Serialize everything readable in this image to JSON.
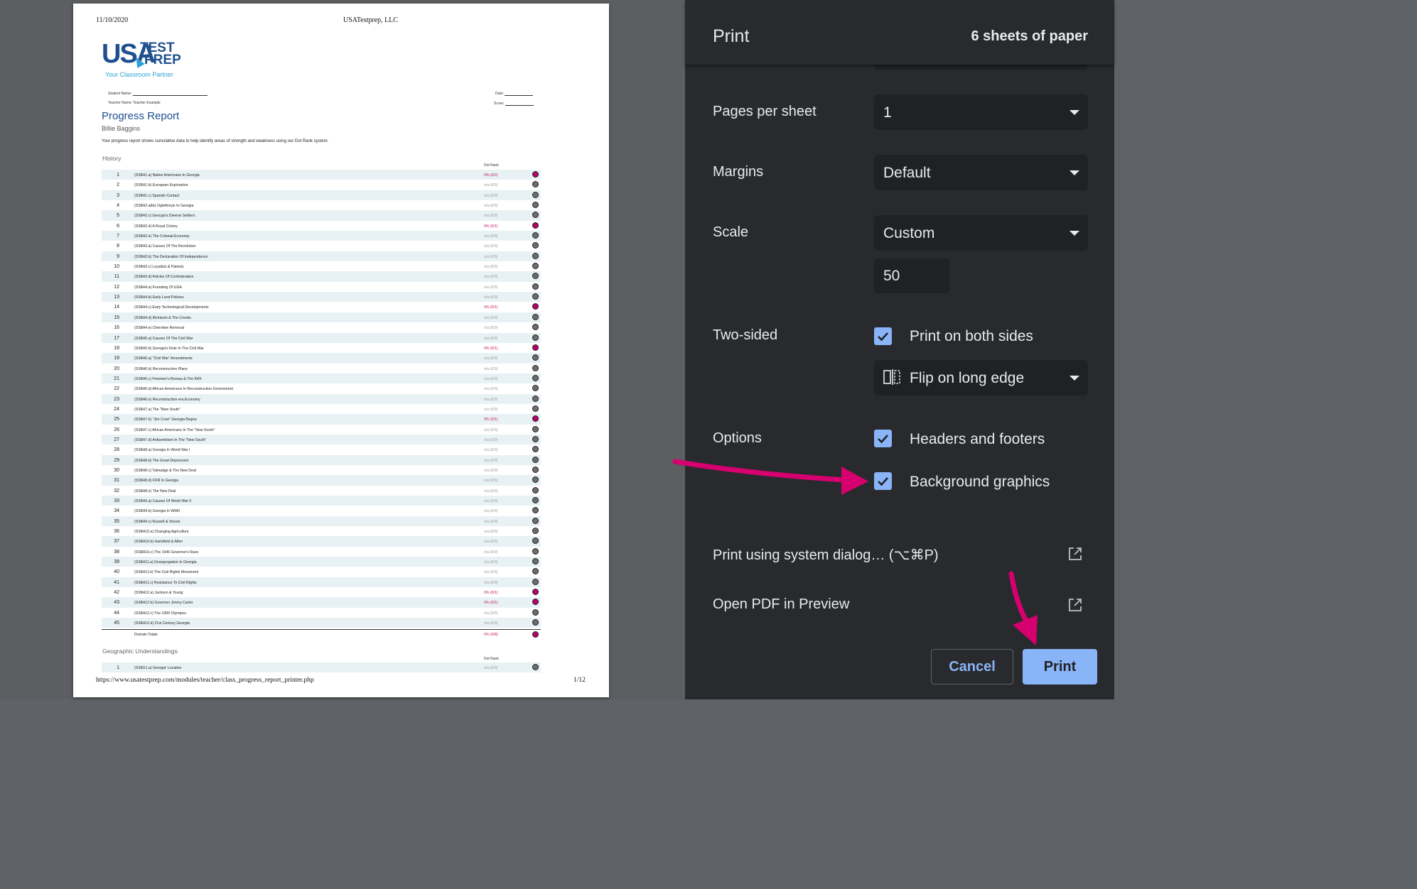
{
  "preview": {
    "header_date": "11/10/2020",
    "header_company": "USATestprep, LLC",
    "logo": {
      "usa": "USA",
      "test": "TEST",
      "prep": "PREP",
      "tagline": "Your Classroom Partner"
    },
    "student_name_label": "Student Name:",
    "teacher_name_label": "Teacher Name: Teacher Example",
    "date_label": "Date:",
    "score_label": "Score:",
    "report_title": "Progress Report",
    "student": "Billie Baggins",
    "description": "Your progress report shows cumulative data to help identify areas of strength and weakness using our Dot Rank system.",
    "section1": "History",
    "dot_rank_label": "Dot Rank",
    "rows": [
      {
        "n": "1",
        "name": "(SS8H1.a) Native Americans In Georgia",
        "pct": "0% (0/2)",
        "hit": true
      },
      {
        "n": "2",
        "name": "(SS8H1.b) European Exploration",
        "pct": "n/a (0/0)",
        "hit": false
      },
      {
        "n": "3",
        "name": "(SS8H1.c) Spanish Contact",
        "pct": "n/a (0/0)",
        "hit": false
      },
      {
        "n": "4",
        "name": "(SS8H2.a&b) Oglethorpe In Georgia",
        "pct": "n/a (0/0)",
        "hit": false
      },
      {
        "n": "5",
        "name": "(SS8H2.c) Georgia's Diverse Settlers",
        "pct": "n/a (0/0)",
        "hit": false
      },
      {
        "n": "6",
        "name": "(SS8H2.d) A Royal Colony",
        "pct": "0% (0/1)",
        "hit": true
      },
      {
        "n": "7",
        "name": "(SS8H2.e) The Colonial Economy",
        "pct": "n/a (0/0)",
        "hit": false
      },
      {
        "n": "8",
        "name": "(SS8H3.a) Causes Of The Revolution",
        "pct": "n/a (0/0)",
        "hit": false
      },
      {
        "n": "9",
        "name": "(SS8H3.b) The Declaration Of Independence",
        "pct": "n/a (0/0)",
        "hit": false
      },
      {
        "n": "10",
        "name": "(SS8H3.c) Loyalists & Patriots",
        "pct": "n/a (0/0)",
        "hit": false
      },
      {
        "n": "11",
        "name": "(SS8H3.d) Articles Of Confederation",
        "pct": "n/a (0/0)",
        "hit": false
      },
      {
        "n": "12",
        "name": "(SS8H4.a) Founding Of UGA",
        "pct": "n/a (0/0)",
        "hit": false
      },
      {
        "n": "13",
        "name": "(SS8H4.b) Early Land Policies",
        "pct": "n/a (0/0)",
        "hit": false
      },
      {
        "n": "14",
        "name": "(SS8H4.c) Early Technological Developments",
        "pct": "0% (0/1)",
        "hit": true
      },
      {
        "n": "15",
        "name": "(SS8H4.d) McIntosh & The Creeks",
        "pct": "n/a (0/0)",
        "hit": false
      },
      {
        "n": "16",
        "name": "(SS8H4.e) Cherokee Removal",
        "pct": "n/a (0/0)",
        "hit": false
      },
      {
        "n": "17",
        "name": "(SS8H5.a) Causes Of The Civil War",
        "pct": "n/a (0/0)",
        "hit": false
      },
      {
        "n": "18",
        "name": "(SS8H5.b) Georgia's Role In The Civil War",
        "pct": "0% (0/1)",
        "hit": true
      },
      {
        "n": "19",
        "name": "(SS8H6.a) \"Civil War\" Amendments",
        "pct": "n/a (0/0)",
        "hit": false
      },
      {
        "n": "20",
        "name": "(SS8H6.b) Reconstruction Plans",
        "pct": "n/a (0/0)",
        "hit": false
      },
      {
        "n": "21",
        "name": "(SS8H6.c) Freemen's Bureau & The KKK",
        "pct": "n/a (0/0)",
        "hit": false
      },
      {
        "n": "22",
        "name": "(SS8H6.d) African Americans In Reconstruction Government",
        "pct": "n/a (0/0)",
        "hit": false
      },
      {
        "n": "23",
        "name": "(SS8H6.e) Reconstruction-era Economy",
        "pct": "n/a (0/0)",
        "hit": false
      },
      {
        "n": "24",
        "name": "(SS8H7.a) The \"New South\"",
        "pct": "n/a (0/0)",
        "hit": false
      },
      {
        "n": "25",
        "name": "(SS8H7.b) \"Jim Crow\" Georgia Begins",
        "pct": "0% (0/1)",
        "hit": true
      },
      {
        "n": "26",
        "name": "(SS8H7.c) African Americans In The \"New South\"",
        "pct": "n/a (0/0)",
        "hit": false
      },
      {
        "n": "27",
        "name": "(SS8H7.d) Antisemitism In The \"New South\"",
        "pct": "n/a (0/0)",
        "hit": false
      },
      {
        "n": "28",
        "name": "(SS8H8.a) Georgia In World War I",
        "pct": "n/a (0/0)",
        "hit": false
      },
      {
        "n": "29",
        "name": "(SS8H8.b) The Great Depression",
        "pct": "n/a (0/0)",
        "hit": false
      },
      {
        "n": "30",
        "name": "(SS8H8.c) Talmadge & The New Deal",
        "pct": "n/a (0/0)",
        "hit": false
      },
      {
        "n": "31",
        "name": "(SS8H8.d) FDR In Georgia",
        "pct": "n/a (0/0)",
        "hit": false
      },
      {
        "n": "32",
        "name": "(SS8H8.e) The New Deal",
        "pct": "n/a (0/0)",
        "hit": false
      },
      {
        "n": "33",
        "name": "(SS8H9.a) Causes Of World War II",
        "pct": "n/a (0/0)",
        "hit": false
      },
      {
        "n": "34",
        "name": "(SS8H9.b) Georgia In WWII",
        "pct": "n/a (0/0)",
        "hit": false
      },
      {
        "n": "35",
        "name": "(SS8H9.c) Russell & Vinson",
        "pct": "n/a (0/0)",
        "hit": false
      },
      {
        "n": "36",
        "name": "(SS8H10.a) Changing Agriculture",
        "pct": "n/a (0/0)",
        "hit": false
      },
      {
        "n": "37",
        "name": "(SS8H10.b) Hartsfield & Allen",
        "pct": "n/a (0/0)",
        "hit": false
      },
      {
        "n": "38",
        "name": "(SS8H10.c) The 1946 Governor's Race",
        "pct": "n/a (0/0)",
        "hit": false
      },
      {
        "n": "39",
        "name": "(SS8H11.a) Desegregation In Georgia",
        "pct": "n/a (0/0)",
        "hit": false
      },
      {
        "n": "40",
        "name": "(SS8H11.b) The Civil Rights Movement",
        "pct": "n/a (0/0)",
        "hit": false
      },
      {
        "n": "41",
        "name": "(SS8H11.c) Resistance To Civil Rights",
        "pct": "n/a (0/0)",
        "hit": false
      },
      {
        "n": "42",
        "name": "(SS8H12.a) Jackson & Young",
        "pct": "0% (0/1)",
        "hit": true
      },
      {
        "n": "43",
        "name": "(SS8H12.b) Governor Jimmy Carter",
        "pct": "0% (0/1)",
        "hit": true
      },
      {
        "n": "44",
        "name": "(SS8H12.c) The 1996 Olympics",
        "pct": "n/a (0/0)",
        "hit": false
      },
      {
        "n": "45",
        "name": "(SS8H12.d) 21st Century Georgia",
        "pct": "n/a (0/0)",
        "hit": false
      }
    ],
    "totals_label": "Domain Totals",
    "totals_pct": "0% (0/8)",
    "section2": "Geographic Understandings",
    "section2_rows": [
      {
        "n": "1",
        "name": "(SS8G1.a) Georgia' Location",
        "pct": "n/a (0/0)",
        "hit": false
      }
    ],
    "footer_url": "https://www.usatestprep.com/modules/teacher/class_progress_report_printer.php",
    "footer_page": "1/12"
  },
  "panel": {
    "title": "Print",
    "sheets": "6 sheets of paper",
    "pages_per_sheet_label": "Pages per sheet",
    "pages_per_sheet_value": "1",
    "margins_label": "Margins",
    "margins_value": "Default",
    "scale_label": "Scale",
    "scale_value": "Custom",
    "scale_custom": "50",
    "two_sided_label": "Two-sided",
    "two_sided_checkbox": "Print on both sides",
    "two_sided_checked": true,
    "flip_value": "Flip on long edge",
    "options_label": "Options",
    "headers_footers": "Headers and footers",
    "headers_footers_checked": true,
    "background_graphics": "Background graphics",
    "background_graphics_checked": true,
    "system_dialog": "Print using system dialog… (⌥⌘P)",
    "open_pdf": "Open PDF in Preview",
    "cancel": "Cancel",
    "print": "Print"
  },
  "colors": {
    "accent": "#8ab4f8",
    "annotation_arrow": "#d6006f",
    "dot_hit": "#b8006b",
    "panel_bg": "#292a2d"
  }
}
